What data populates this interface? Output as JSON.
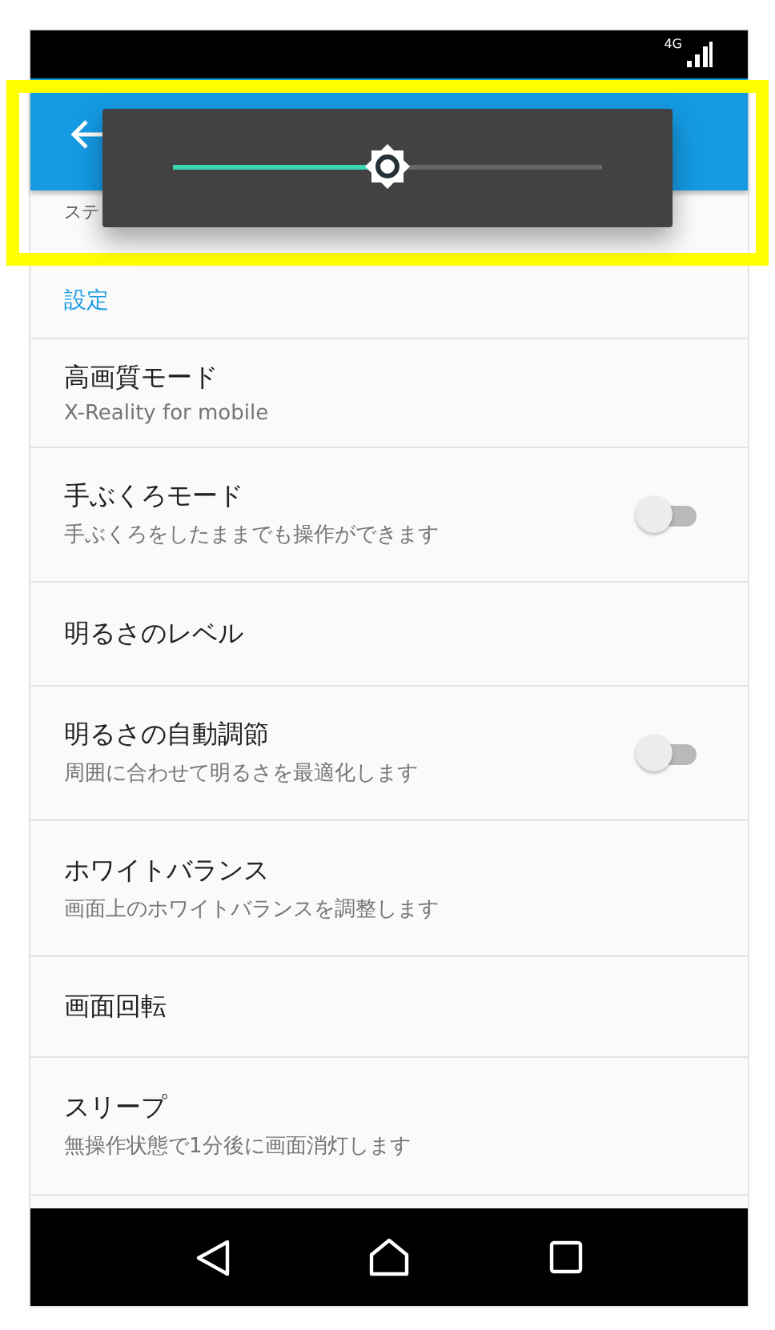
{
  "status_bar": {
    "network": "4G"
  },
  "partial_item": "ステ",
  "section": "設定",
  "settings": [
    {
      "kind": "text",
      "title": "高画質モード",
      "summary": "X-Reality for mobile"
    },
    {
      "kind": "toggle",
      "title": "手ぶくろモード",
      "summary": "手ぶくろをしたままでも操作ができます",
      "on": false
    },
    {
      "kind": "text",
      "title": "明るさのレベル"
    },
    {
      "kind": "toggle",
      "title": "明るさの自動調節",
      "summary": "周囲に合わせて明るさを最適化します",
      "on": false
    },
    {
      "kind": "text",
      "title": "ホワイトバランス",
      "summary": "画面上のホワイトバランスを調整します"
    },
    {
      "kind": "text",
      "title": "画面回転"
    },
    {
      "kind": "text",
      "title": "スリープ",
      "summary": "無操作状態で1分後に画面消灯します"
    }
  ],
  "brightness_dialog": {
    "level": 0.5
  }
}
